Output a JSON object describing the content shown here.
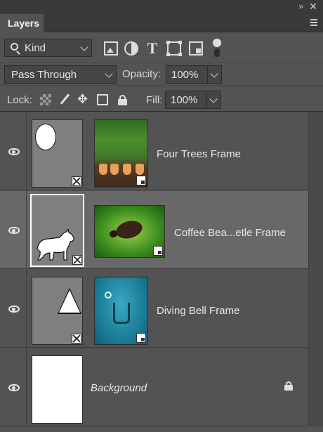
{
  "panel": {
    "tab_label": "Layers",
    "collapse_glyph": "»",
    "close_glyph": "✕"
  },
  "filter": {
    "kind_label": "Kind",
    "icons": [
      "image-filter-icon",
      "adjustment-filter-icon",
      "type-filter-icon",
      "shape-filter-icon",
      "smart-object-filter-icon",
      "filter-toggle-icon"
    ],
    "type_glyph": "T"
  },
  "blend": {
    "mode": "Pass Through",
    "opacity_label": "Opacity:",
    "opacity_value": "100%"
  },
  "lock": {
    "label": "Lock:",
    "fill_label": "Fill:",
    "fill_value": "100%",
    "move_glyph": "✥"
  },
  "layers": [
    {
      "name": "Four Trees Frame",
      "mask_shape": "ellipse",
      "visible": true,
      "selected": false
    },
    {
      "name": "Coffee Bea...etle Frame",
      "mask_shape": "cat",
      "visible": true,
      "selected": true
    },
    {
      "name": "Diving Bell Frame",
      "mask_shape": "triangle",
      "visible": true,
      "selected": false
    },
    {
      "name": "Background",
      "visible": true,
      "selected": false,
      "locked": true
    }
  ],
  "colors": {
    "panel_bg": "#535353",
    "selected_row_bg": "#686868",
    "text": "#e6e6e6"
  }
}
